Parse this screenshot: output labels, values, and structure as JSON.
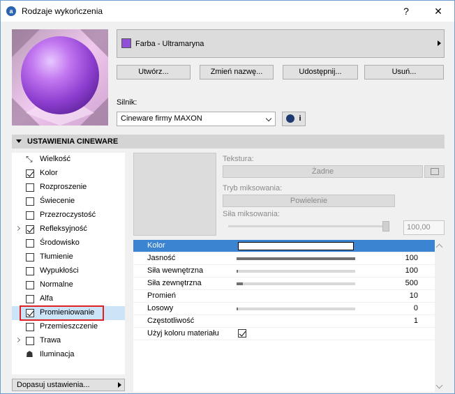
{
  "window": {
    "title": "Rodzaje wykończenia",
    "help_label": "?",
    "close_label": "✕"
  },
  "material": {
    "name": "Farba - Ultramaryna",
    "swatch_color": "#8f4fd8"
  },
  "actions": {
    "create": "Utwórz...",
    "rename": "Zmień nazwę...",
    "share": "Udostępnij...",
    "delete": "Usuń..."
  },
  "engine": {
    "label": "Silnik:",
    "value": "Cineware firmy MAXON",
    "info_label": "i"
  },
  "section": {
    "title": "USTAWIENIA CINEWARE"
  },
  "channels": [
    {
      "label": "Wielkość",
      "checkbox": false,
      "icon": "size-icon",
      "expander": false
    },
    {
      "label": "Kolor",
      "checkbox": true,
      "checked": true,
      "expander": false
    },
    {
      "label": "Rozproszenie",
      "checkbox": true,
      "checked": false,
      "expander": false
    },
    {
      "label": "Świecenie",
      "checkbox": true,
      "checked": false,
      "expander": false
    },
    {
      "label": "Przezroczystość",
      "checkbox": true,
      "checked": false,
      "expander": false
    },
    {
      "label": "Refleksyjność",
      "checkbox": true,
      "checked": true,
      "expander": true
    },
    {
      "label": "Środowisko",
      "checkbox": true,
      "checked": false,
      "expander": false
    },
    {
      "label": "Tłumienie",
      "checkbox": true,
      "checked": false,
      "expander": false
    },
    {
      "label": "Wypukłości",
      "checkbox": true,
      "checked": false,
      "expander": false
    },
    {
      "label": "Normalne",
      "checkbox": true,
      "checked": false,
      "expander": false
    },
    {
      "label": "Alfa",
      "checkbox": true,
      "checked": false,
      "expander": false
    },
    {
      "label": "Promieniowanie",
      "checkbox": true,
      "checked": true,
      "expander": false,
      "selected": true
    },
    {
      "label": "Przemieszczenie",
      "checkbox": true,
      "checked": false,
      "expander": false
    },
    {
      "label": "Trawa",
      "checkbox": true,
      "checked": false,
      "expander": true
    },
    {
      "label": "Iluminacja",
      "checkbox": false,
      "icon": "illumination-icon",
      "expander": false
    }
  ],
  "adjust_button": "Dopasuj ustawienia...",
  "texture": {
    "label": "Tekstura:",
    "value": "Żadne",
    "blend_mode_label": "Tryb miksowania:",
    "blend_mode_value": "Powielenie",
    "blend_strength_label": "Siła miksowania:",
    "blend_strength_value": "100,00",
    "blend_strength_level": 1.0
  },
  "properties": [
    {
      "name": "Kolor",
      "type": "color",
      "active": true,
      "value": ""
    },
    {
      "name": "Jasność",
      "type": "slider",
      "value": "100",
      "level": 1.0
    },
    {
      "name": "Siła wewnętrzna",
      "type": "slider",
      "value": "100",
      "level": 0.0
    },
    {
      "name": "Siła zewnętrzna",
      "type": "slider",
      "value": "500",
      "level": 0.05
    },
    {
      "name": "Promień",
      "type": "number",
      "value": "10"
    },
    {
      "name": "Losowy",
      "type": "slider",
      "value": "0",
      "level": 0.0
    },
    {
      "name": "Częstotliwość",
      "type": "number",
      "value": "1"
    },
    {
      "name": "Użyj koloru materiału",
      "type": "checkbox",
      "value": "",
      "checked": true
    }
  ]
}
